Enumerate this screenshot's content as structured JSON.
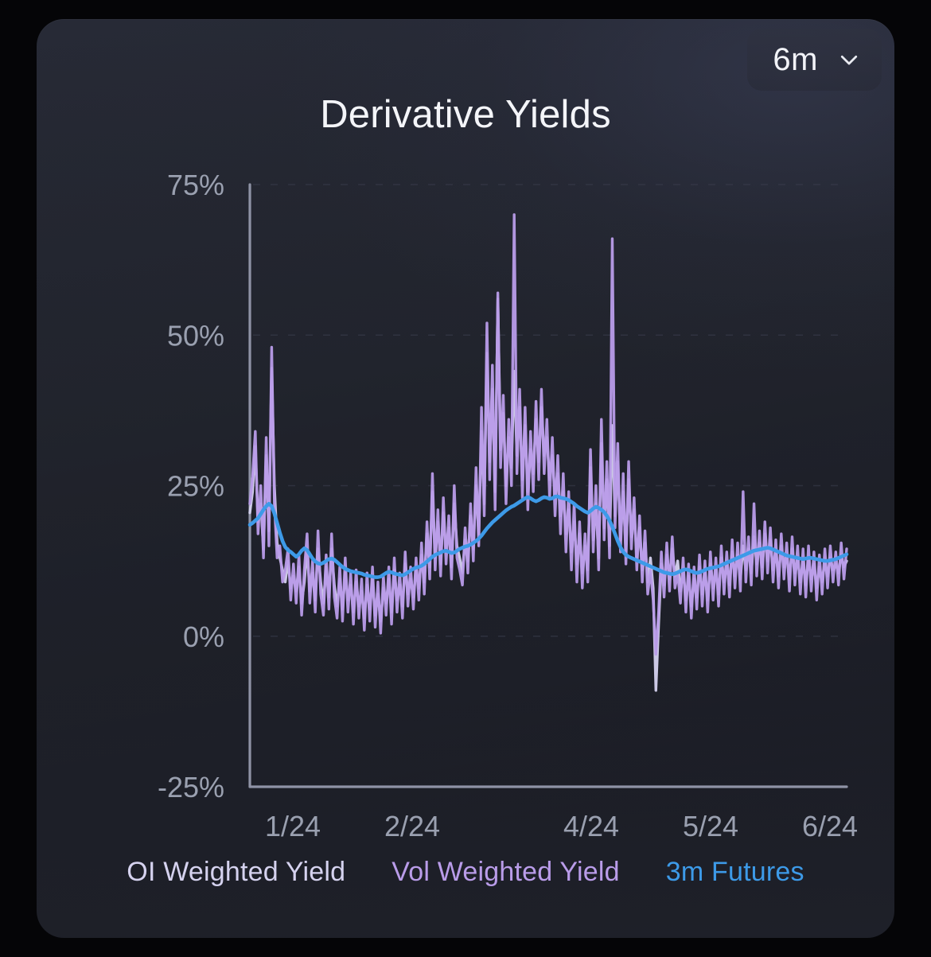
{
  "card": {
    "title": "Derivative Yields",
    "background_color": "#23262f",
    "page_background": "#050507"
  },
  "range_selector": {
    "value": "6m",
    "icon": "chevron-down-icon"
  },
  "legend": {
    "items": [
      {
        "label": "OI Weighted Yield",
        "color": "#d5d2ef"
      },
      {
        "label": "Vol Weighted Yield",
        "color": "#b99ce9"
      },
      {
        "label": "3m Futures",
        "color": "#3d9ae8"
      }
    ]
  },
  "chart_data": {
    "type": "line",
    "title": "Derivative Yields",
    "xlabel": "",
    "ylabel": "",
    "ylim": [
      -25,
      75
    ],
    "yticks": [
      75,
      50,
      25,
      0,
      -25
    ],
    "ytick_labels": [
      "75%",
      "50%",
      "25%",
      "0%",
      "-25%"
    ],
    "xtick_labels": [
      "1/24",
      "2/24",
      "4/24",
      "5/24",
      "6/24"
    ],
    "xtick_positions": [
      0.072,
      0.272,
      0.572,
      0.772,
      0.972
    ],
    "grid": "horizontal-dashed",
    "grid_color": "#3a3d4d",
    "axis_color": "#8f93a6",
    "legend_position": "bottom-center",
    "series": [
      {
        "name": "OI Weighted Yield",
        "color": "#d5d2ef",
        "values": [
          20.5,
          24.0,
          31.5,
          19.0,
          22.0,
          14.5,
          30.0,
          17.5,
          44.5,
          25.0,
          15.5,
          13.0,
          11.0,
          9.0,
          12.5,
          8.0,
          10.0,
          7.5,
          11.5,
          5.5,
          9.0,
          14.5,
          7.5,
          10.5,
          6.0,
          14.5,
          9.0,
          5.5,
          11.5,
          6.5,
          14.5,
          8.5,
          5.0,
          9.5,
          4.5,
          10.5,
          6.0,
          8.5,
          4.0,
          9.0,
          5.0,
          7.5,
          3.0,
          8.5,
          4.5,
          9.5,
          3.5,
          7.0,
          2.5,
          8.0,
          5.5,
          9.5,
          4.0,
          11.0,
          6.0,
          8.5,
          5.0,
          12.0,
          7.0,
          9.5,
          6.5,
          11.0,
          8.0,
          13.5,
          9.0,
          17.0,
          11.5,
          24.0,
          13.0,
          19.0,
          12.0,
          20.5,
          14.0,
          18.0,
          11.5,
          22.0,
          15.0,
          13.0,
          10.5,
          16.0,
          12.5,
          20.0,
          14.5,
          25.0,
          17.0,
          34.0,
          22.0,
          47.0,
          29.0,
          41.0,
          24.0,
          56.0,
          31.0,
          37.0,
          25.0,
          33.0,
          28.0,
          44.0,
          30.0,
          38.0,
          26.0,
          35.0,
          24.0,
          31.0,
          27.0,
          36.0,
          29.0,
          38.0,
          30.0,
          33.0,
          26.0,
          30.0,
          23.0,
          27.0,
          20.0,
          24.0,
          17.0,
          21.0,
          14.0,
          19.0,
          12.0,
          17.0,
          10.5,
          15.0,
          11.0,
          28.0,
          16.0,
          22.0,
          13.0,
          32.0,
          18.0,
          26.0,
          15.0,
          35.0,
          20.0,
          29.0,
          16.0,
          24.0,
          14.0,
          26.0,
          16.5,
          21.0,
          13.0,
          18.0,
          11.0,
          15.5,
          9.0,
          13.0,
          8.0,
          -9.0,
          2.0,
          12.0,
          8.5,
          13.5,
          9.5,
          14.5,
          10.0,
          12.5,
          7.5,
          11.0,
          6.0,
          10.0,
          5.0,
          9.5,
          6.5,
          11.5,
          7.0,
          10.5,
          6.0,
          12.0,
          8.0,
          11.0,
          7.0,
          13.0,
          9.0,
          12.0,
          8.5,
          14.0,
          10.0,
          13.5,
          9.5,
          15.0,
          11.0,
          14.5,
          10.5,
          16.5,
          12.0,
          15.5,
          11.5,
          17.0,
          12.5,
          16.0,
          11.0,
          14.0,
          10.0,
          15.0,
          11.5,
          13.5,
          9.5,
          14.5,
          10.5,
          13.0,
          9.0,
          12.5,
          8.5,
          13.0,
          9.5,
          12.0,
          8.0,
          11.5,
          9.0,
          12.5,
          10.0,
          13.0,
          11.0,
          12.0,
          10.5,
          13.5,
          11.5,
          12.5
        ]
      },
      {
        "name": "Vol Weighted Yield",
        "color": "#b99ce9",
        "values": [
          22.0,
          26.5,
          34.0,
          17.0,
          25.0,
          13.0,
          33.0,
          15.0,
          48.0,
          22.0,
          13.0,
          15.0,
          9.0,
          11.0,
          14.5,
          6.0,
          12.0,
          5.5,
          13.5,
          3.5,
          11.0,
          17.0,
          5.5,
          12.5,
          4.0,
          17.5,
          7.0,
          3.5,
          13.5,
          4.5,
          17.0,
          6.5,
          3.0,
          11.5,
          2.5,
          13.0,
          4.0,
          10.5,
          2.0,
          11.0,
          3.0,
          9.5,
          1.0,
          10.5,
          2.5,
          11.5,
          1.5,
          9.0,
          0.5,
          10.0,
          3.5,
          11.5,
          2.0,
          13.0,
          4.0,
          10.5,
          3.0,
          14.0,
          5.0,
          11.5,
          4.5,
          13.0,
          6.0,
          15.5,
          7.0,
          19.0,
          9.5,
          27.0,
          11.0,
          21.0,
          10.0,
          23.0,
          12.0,
          20.0,
          9.5,
          25.0,
          13.0,
          11.0,
          8.5,
          18.0,
          10.5,
          22.0,
          12.5,
          28.0,
          15.0,
          38.0,
          20.0,
          52.0,
          26.0,
          45.0,
          21.0,
          57.0,
          28.0,
          40.0,
          22.0,
          36.0,
          25.0,
          70.0,
          27.0,
          41.0,
          23.0,
          38.0,
          21.0,
          34.0,
          24.0,
          39.0,
          26.0,
          41.0,
          27.0,
          36.0,
          23.0,
          33.0,
          20.0,
          30.0,
          17.0,
          27.0,
          14.0,
          24.0,
          11.0,
          22.0,
          9.0,
          19.0,
          8.0,
          17.0,
          9.0,
          31.0,
          14.0,
          25.0,
          11.0,
          36.0,
          16.0,
          29.0,
          13.0,
          66.0,
          18.0,
          32.0,
          14.0,
          27.0,
          12.0,
          29.0,
          14.5,
          23.0,
          11.0,
          20.0,
          9.0,
          17.5,
          7.0,
          11.0,
          6.0,
          -3.0,
          4.0,
          14.0,
          6.5,
          15.5,
          7.5,
          16.5,
          8.0,
          10.5,
          5.5,
          13.0,
          4.0,
          12.0,
          3.0,
          11.5,
          4.5,
          13.5,
          5.0,
          12.5,
          4.0,
          14.0,
          6.0,
          13.0,
          5.0,
          15.0,
          7.0,
          14.0,
          6.5,
          16.0,
          8.0,
          15.5,
          7.5,
          24.0,
          9.0,
          16.5,
          8.5,
          22.0,
          10.0,
          17.5,
          9.5,
          19.0,
          10.5,
          18.0,
          9.0,
          16.0,
          8.0,
          17.0,
          9.5,
          15.5,
          7.5,
          16.5,
          8.5,
          15.0,
          7.0,
          14.5,
          6.5,
          15.0,
          7.5,
          14.0,
          6.0,
          13.5,
          7.0,
          14.5,
          8.0,
          15.0,
          9.0,
          14.0,
          8.5,
          15.5,
          9.5,
          14.5
        ]
      },
      {
        "name": "3m Futures",
        "color": "#3d9ae8",
        "values": [
          18.5,
          18.8,
          19.2,
          19.6,
          20.3,
          21.0,
          21.6,
          22.0,
          21.6,
          20.4,
          18.8,
          17.2,
          15.8,
          14.8,
          14.3,
          14.0,
          13.6,
          13.2,
          13.6,
          14.2,
          14.6,
          14.3,
          13.6,
          12.9,
          12.4,
          12.1,
          12.0,
          12.2,
          12.5,
          12.8,
          12.9,
          12.7,
          12.3,
          11.9,
          11.5,
          11.2,
          11.0,
          10.8,
          10.7,
          10.6,
          10.5,
          10.4,
          10.2,
          10.1,
          10.0,
          9.9,
          9.8,
          9.8,
          9.9,
          10.2,
          10.5,
          10.7,
          10.6,
          10.4,
          10.3,
          10.2,
          10.1,
          10.3,
          10.6,
          10.9,
          11.2,
          11.4,
          11.5,
          11.7,
          12.0,
          12.4,
          12.8,
          13.2,
          13.5,
          13.7,
          13.9,
          14.1,
          14.2,
          14.0,
          13.8,
          13.9,
          14.2,
          14.5,
          14.7,
          14.9,
          15.0,
          15.2,
          15.5,
          15.8,
          16.2,
          16.7,
          17.3,
          17.9,
          18.4,
          18.9,
          19.3,
          19.7,
          20.1,
          20.5,
          20.9,
          21.2,
          21.5,
          21.7,
          22.0,
          22.3,
          22.6,
          22.9,
          23.1,
          22.9,
          22.6,
          22.4,
          22.6,
          22.9,
          23.1,
          23.0,
          22.8,
          22.9,
          23.2,
          23.2,
          23.0,
          22.9,
          22.8,
          22.6,
          22.3,
          22.0,
          21.6,
          21.3,
          21.0,
          20.7,
          20.5,
          20.8,
          21.2,
          21.5,
          21.3,
          21.0,
          20.6,
          20.0,
          19.2,
          18.2,
          17.0,
          15.8,
          14.8,
          14.0,
          13.5,
          13.2,
          13.0,
          12.8,
          12.6,
          12.4,
          12.2,
          12.0,
          11.8,
          11.6,
          11.4,
          11.2,
          11.0,
          10.8,
          10.6,
          10.5,
          10.4,
          10.3,
          10.4,
          10.6,
          10.8,
          11.0,
          11.1,
          11.0,
          10.8,
          10.6,
          10.5,
          10.6,
          10.8,
          11.0,
          11.2,
          11.3,
          11.4,
          11.5,
          11.6,
          11.8,
          12.0,
          12.2,
          12.4,
          12.6,
          12.8,
          13.0,
          13.2,
          13.4,
          13.6,
          13.8,
          14.0,
          14.2,
          14.3,
          14.4,
          14.5,
          14.6,
          14.7,
          14.6,
          14.4,
          14.2,
          14.0,
          13.8,
          13.6,
          13.4,
          13.3,
          13.2,
          13.1,
          13.0,
          12.9,
          12.8,
          12.9,
          13.0,
          13.0,
          12.9,
          12.8,
          12.7,
          12.6,
          12.5,
          12.5,
          12.6,
          12.7,
          12.8,
          13.0,
          13.2,
          13.4,
          13.6
        ]
      }
    ]
  }
}
